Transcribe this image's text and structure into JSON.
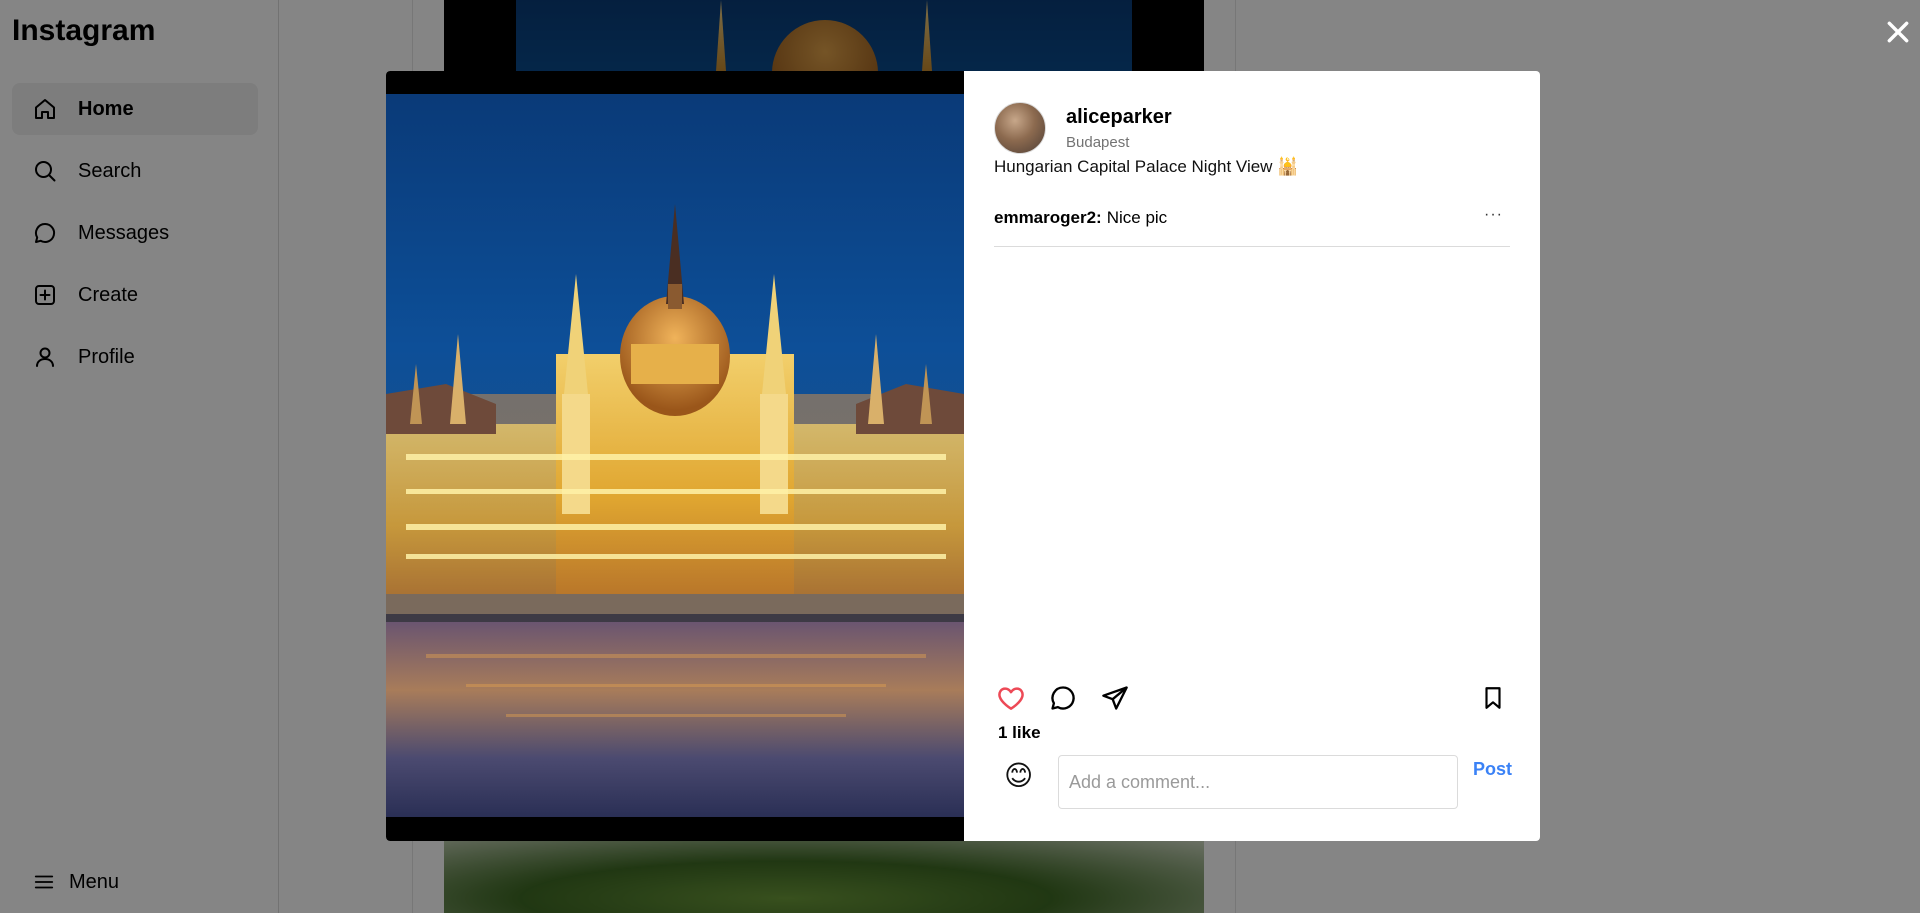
{
  "app": {
    "logo": "Instagram"
  },
  "sidebar": {
    "items": [
      {
        "label": "Home",
        "icon": "home-icon",
        "active": true
      },
      {
        "label": "Search",
        "icon": "search-icon"
      },
      {
        "label": "Messages",
        "icon": "messages-icon"
      },
      {
        "label": "Create",
        "icon": "create-icon"
      },
      {
        "label": "Profile",
        "icon": "profile-icon"
      }
    ],
    "menu_label": "Menu"
  },
  "post": {
    "username": "aliceparker",
    "location": "Budapest",
    "caption": "Hungarian Capital Palace Night View 🕌",
    "comments": [
      {
        "user": "emmaroger2:",
        "text": "Nice pic"
      }
    ],
    "likes_text": "1 like",
    "comment_placeholder": "Add a comment...",
    "post_button": "Post",
    "emoji": "😊"
  },
  "colors": {
    "like": "#ed4956",
    "post_button": "#3b82f6",
    "active_nav_bg": "#efefef"
  }
}
